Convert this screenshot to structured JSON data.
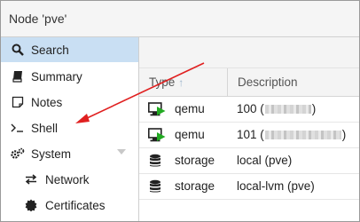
{
  "window": {
    "title": "Node 'pve'"
  },
  "sidebar": {
    "items": [
      {
        "label": "Search",
        "icon": "search-icon",
        "active": true
      },
      {
        "label": "Summary",
        "icon": "book-icon"
      },
      {
        "label": "Notes",
        "icon": "notes-icon"
      },
      {
        "label": "Shell",
        "icon": "terminal-icon"
      },
      {
        "label": "System",
        "icon": "gears-icon",
        "expandable": true
      },
      {
        "label": "Network",
        "icon": "exchange-icon",
        "sub": true
      },
      {
        "label": "Certificates",
        "icon": "certificate-icon",
        "sub": true
      }
    ]
  },
  "grid": {
    "columns": {
      "type": "Type",
      "description": "Description"
    },
    "sort": {
      "column": "type",
      "direction": "ascending"
    },
    "rows": [
      {
        "type": "qemu",
        "icon": "vm-running-icon",
        "desc_prefix": "100 (",
        "desc_suffix": ")"
      },
      {
        "type": "qemu",
        "icon": "vm-running-icon",
        "desc_prefix": "101 (",
        "desc_suffix": ")"
      },
      {
        "type": "storage",
        "icon": "database-icon",
        "description": "local (pve)"
      },
      {
        "type": "storage",
        "icon": "database-icon",
        "description": "local-lvm (pve)"
      }
    ]
  },
  "colors": {
    "active_item_bg": "#c9dff3",
    "annotation_arrow": "#e02020",
    "running_green": "#22aa22"
  }
}
